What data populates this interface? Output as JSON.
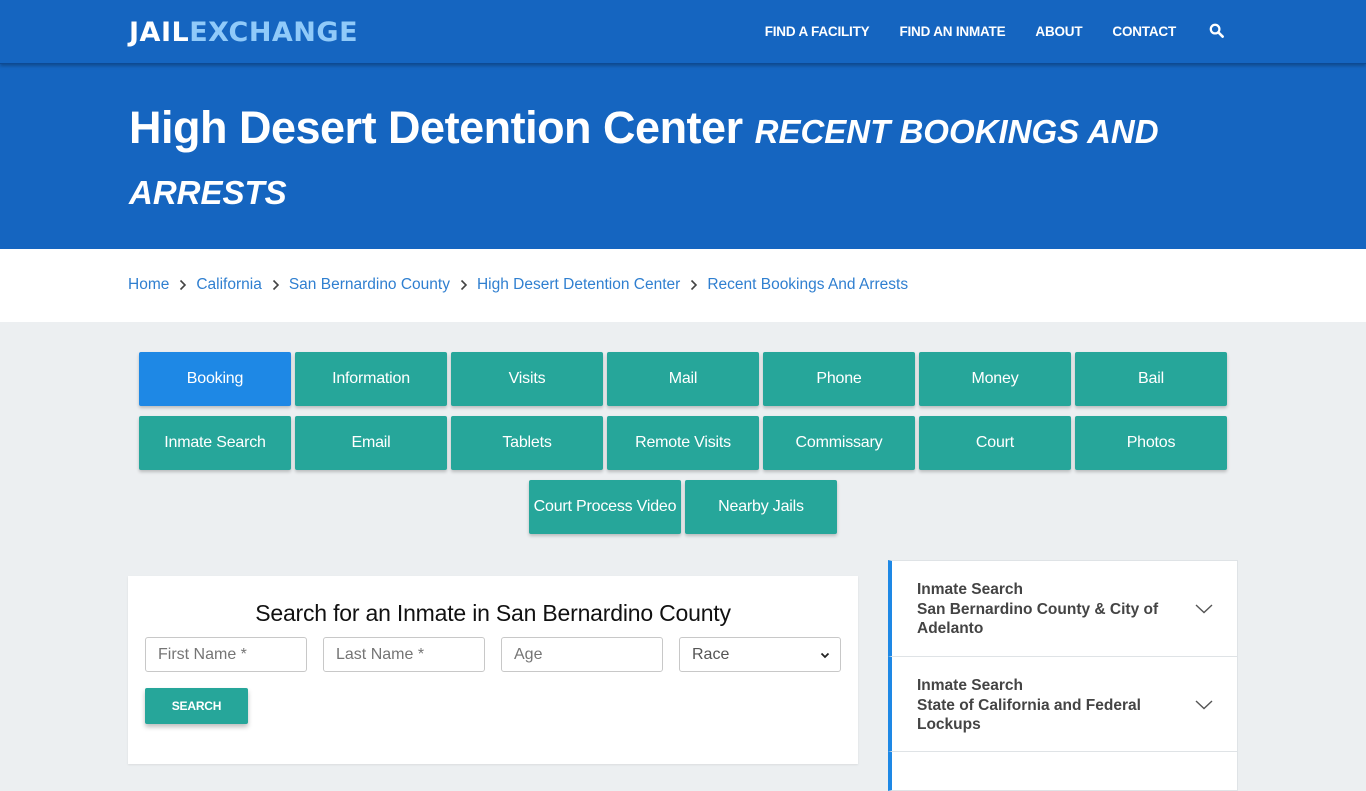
{
  "header": {
    "logo_part1": "JAIL",
    "logo_part2": "EXCHANGE",
    "nav": [
      {
        "label": "FIND A FACILITY"
      },
      {
        "label": "FIND AN INMATE"
      },
      {
        "label": "ABOUT"
      },
      {
        "label": "CONTACT"
      }
    ],
    "search_icon": "search-icon"
  },
  "hero": {
    "title": "High Desert Detention Center",
    "subtitle": "RECENT BOOKINGS AND ARRESTS"
  },
  "breadcrumb": [
    {
      "label": "Home"
    },
    {
      "label": "California"
    },
    {
      "label": "San Bernardino County"
    },
    {
      "label": "High Desert Detention Center"
    },
    {
      "label": "Recent Bookings And Arrests"
    }
  ],
  "buttons": [
    {
      "label": "Booking",
      "active": true
    },
    {
      "label": "Information"
    },
    {
      "label": "Visits"
    },
    {
      "label": "Mail"
    },
    {
      "label": "Phone"
    },
    {
      "label": "Money"
    },
    {
      "label": "Bail"
    },
    {
      "label": "Inmate Search"
    },
    {
      "label": "Email"
    },
    {
      "label": "Tablets"
    },
    {
      "label": "Remote Visits"
    },
    {
      "label": "Commissary"
    },
    {
      "label": "Court"
    },
    {
      "label": "Photos"
    },
    {
      "label": "Court Process Video"
    },
    {
      "label": "Nearby Jails"
    }
  ],
  "search": {
    "title": "Search for an Inmate in San Bernardino County",
    "first_name_placeholder": "First Name *",
    "last_name_placeholder": "Last Name *",
    "age_placeholder": "Age",
    "race_selected": "Race",
    "button_label": "SEARCH"
  },
  "sidebar": {
    "items": [
      {
        "line1": "Inmate Search",
        "line2": "San Bernardino County & City of Adelanto"
      },
      {
        "line1": "Inmate Search",
        "line2": "State of California and Federal Lockups"
      }
    ]
  },
  "colors": {
    "brand_blue": "#1565c0",
    "accent_teal": "#26a69a",
    "active_blue": "#1e88e5",
    "logo_light": "#90caf9",
    "link_blue": "#2f7fd0"
  }
}
